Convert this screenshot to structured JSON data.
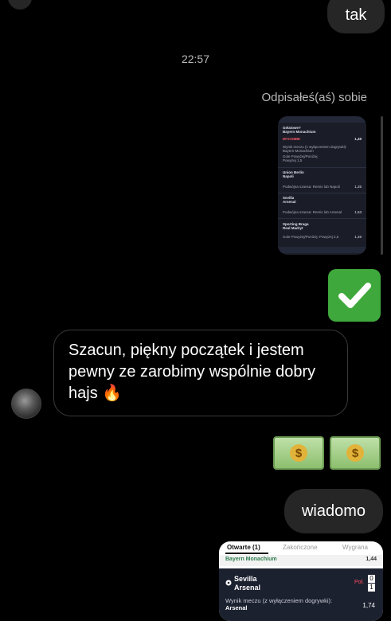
{
  "messages": {
    "out_1": "tak",
    "timestamp": "22:57",
    "reply_note": "Odpisałeś(aś) sobie",
    "in_1": "Szacun, piękny początek i jestem pewny ze zarobimy wspólnie dobry hajs 🔥",
    "out_2": "wiadomo"
  },
  "thumb": {
    "match1_team1": "Gelatowe?",
    "match1_team2": "Bayern Monachium",
    "badge": "MYCOMBI",
    "odd1": "1,49",
    "line1": "Wynik meczu (z wyłączeniem dogrywki):",
    "line1b": "Bayern Monachium",
    "line2": "Gole Powyżej/Poniżej",
    "line2b": "Powyżej 1,5",
    "match2_team1": "Union Berlin",
    "match2_team2": "Napoli",
    "line3": "Podwójna szansa: Remis lub Napoli",
    "odd3": "1,25",
    "match3_team1": "Sevilla",
    "match3_team2": "Arsenal",
    "line4": "Podwójna szansa: Remis lub Arsenal",
    "odd4": "1,53",
    "match4_team1": "Sporting Braga",
    "match4_team2": "Real Madryt",
    "line5": "Gole Powyżej/Poniżej: Powyżej 2,5",
    "odd5": "1,46"
  },
  "card": {
    "tab1": "Otwarte (1)",
    "tab2": "Zakończone",
    "tab3": "Wygrana",
    "sub_team": "Bayern Monachium",
    "sub_odd": "1,44",
    "team1": "Sevilla",
    "team2": "Arsenal",
    "pol": "Poł.",
    "score1": "0",
    "score2": "1",
    "market": "Wynik meczu (z wyłączeniem dogrywki):",
    "market_pick": "Arsenal",
    "odd": "1,74"
  },
  "emojis": {
    "check": "✔",
    "dollar": "$"
  }
}
